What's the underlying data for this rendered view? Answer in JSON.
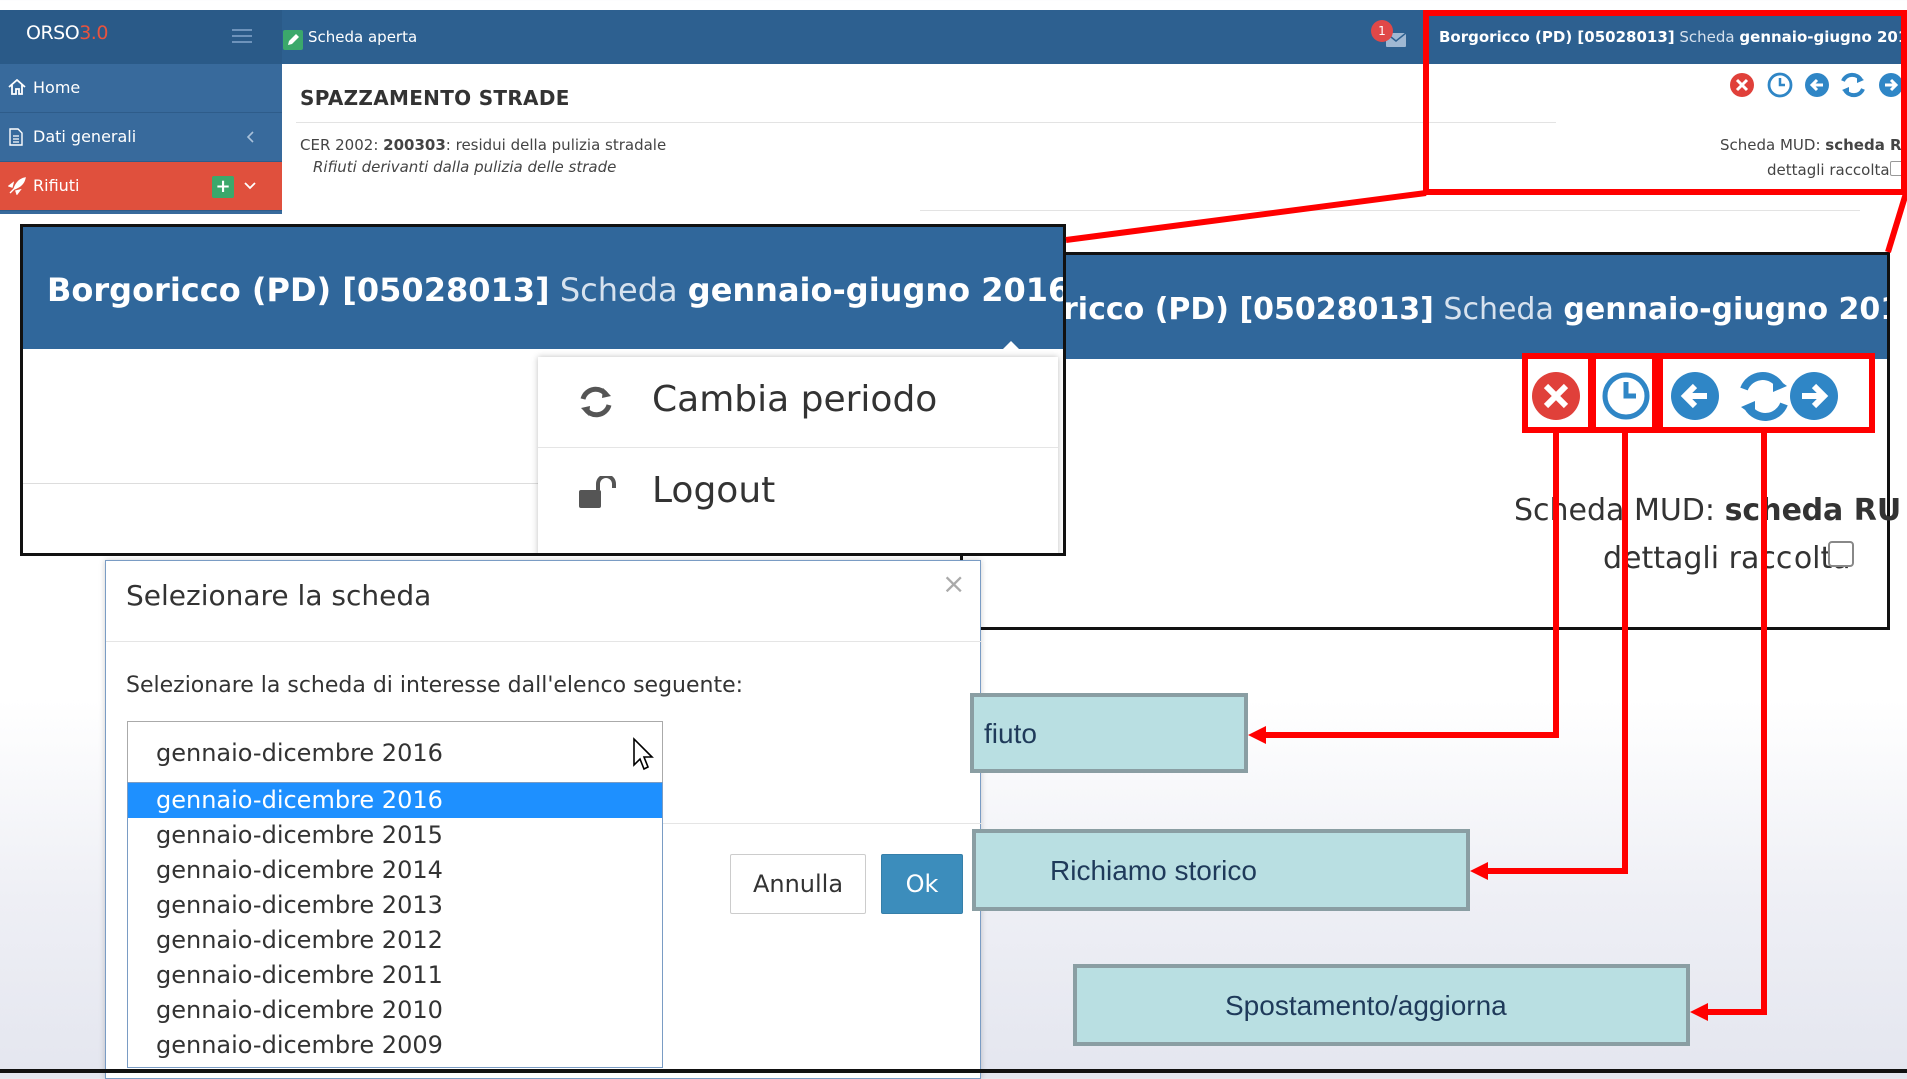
{
  "app": {
    "brand_main": "ORSO",
    "brand_version": "3.0",
    "open_label": "Scheda aperta",
    "notification_count": "1"
  },
  "header_right": {
    "location": "Borgoricco (PD) [05028013]",
    "scheda_word": "Scheda",
    "period": "gennaio-giugno 2016"
  },
  "sidebar": {
    "items": [
      {
        "label": "Home",
        "icon": "home-icon"
      },
      {
        "label": "Dati generali",
        "icon": "document-icon"
      },
      {
        "label": "Rifiuti",
        "icon": "rocket-icon"
      }
    ]
  },
  "page": {
    "title": "SPAZZAMENTO STRADE",
    "cer_prefix": "CER 2002:",
    "cer_code": "200303",
    "cer_text": ": residui della pulizia stradale",
    "cer_desc": "Rifiuti derivanti dalla pulizia delle strade",
    "mud_label": "Scheda MUD:",
    "mud_value": "scheda RU",
    "details_label": "dettagli raccolta"
  },
  "zoom_right": {
    "header_location": "ricco (PD) [05028013]",
    "mud_label_a": "Sc",
    "mud_label_b": "h",
    "mud_label_c": "eda MUD: ",
    "mud_value_a": "sch",
    "mud_value_b": "e",
    "mud_value_c": "da RU",
    "details_a": "d",
    "details_b": "ettagli rac",
    "details_c": "c",
    "details_d": "olta"
  },
  "dropdown_menu": {
    "items": [
      {
        "label": "Cambia periodo",
        "icon": "refresh-icon"
      },
      {
        "label": "Logout",
        "icon": "unlock-icon"
      }
    ]
  },
  "modal": {
    "title": "Selezionare la scheda",
    "close": "×",
    "instructions": "Selezionare la scheda di interesse dall'elenco seguente:",
    "selected": "gennaio-dicembre 2016",
    "options": [
      "gennaio-dicembre 2016",
      "gennaio-dicembre 2015",
      "gennaio-dicembre 2014",
      "gennaio-dicembre 2013",
      "gennaio-dicembre 2012",
      "gennaio-dicembre 2011",
      "gennaio-dicembre 2010",
      "gennaio-dicembre 2009"
    ],
    "cancel_label": "Annulla",
    "ok_label": "Ok"
  },
  "callouts": [
    "fiuto",
    "Richiamo storico",
    "Spostamento/aggiorna"
  ],
  "colors": {
    "topbar": "#2d6090",
    "sidebar": "#386a9c",
    "active_item": "#e0503d",
    "highlight": "#ff0000",
    "callout_bg": "#b9dfe2",
    "selected_option": "#1e90ff"
  }
}
